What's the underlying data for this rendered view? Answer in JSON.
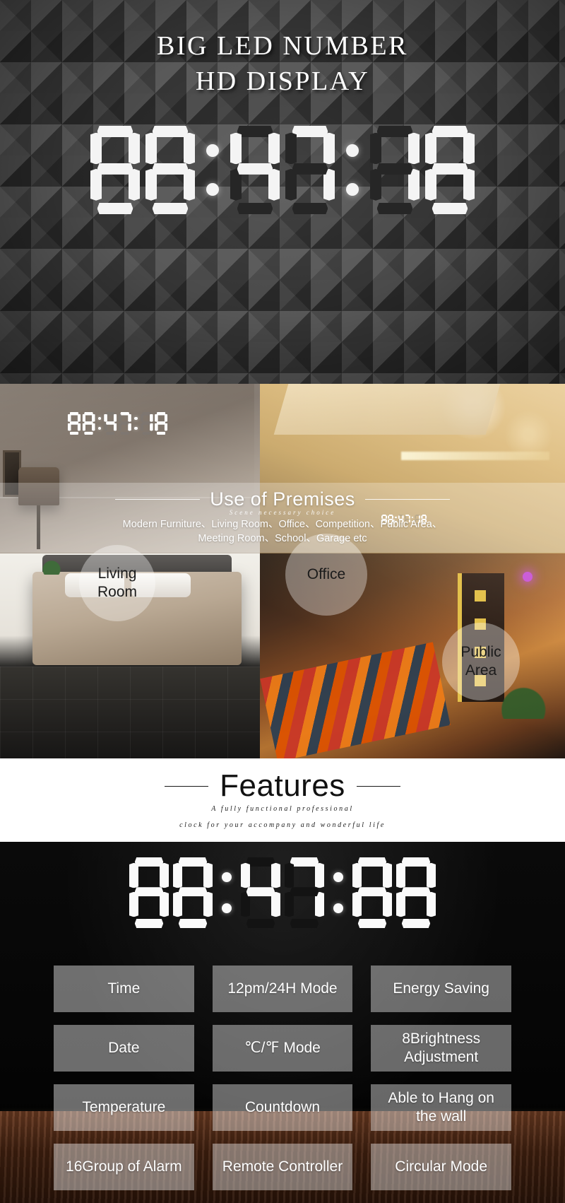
{
  "hero": {
    "title_line1": "BIG LED NUMBER",
    "title_line2": "HD DISPLAY",
    "clock_time": "88:47:18",
    "digits": [
      "8",
      "8",
      "4",
      "7",
      "1",
      "8"
    ]
  },
  "premises": {
    "title": "Use of Premises",
    "subtitle": "Scene necessary choice",
    "list_line1": "Modern Furniture、Living Room、Office、Competition、Public Area、",
    "list_line2": "Meeting Room、School、Garage etc",
    "badges": [
      {
        "id": "living-room",
        "line1": "Living",
        "line2": "Room"
      },
      {
        "id": "office",
        "line1": "Office",
        "line2": ""
      },
      {
        "id": "public-area",
        "line1": "Public",
        "line2": "Area"
      }
    ],
    "mini_clock_time": "88:47:18"
  },
  "features_header": {
    "title": "Features",
    "subtitle_line1": "A fully functional professional",
    "subtitle_line2": "clock for your accompany and wonderful life"
  },
  "features_grid": {
    "clock_time": "88:47:88",
    "items": [
      "Time",
      "12pm/24H Mode",
      "Energy Saving",
      "Date",
      "℃/℉ Mode",
      "8Brightness Adjustment",
      "Temperature",
      "Countdown",
      "Able to Hang on the wall",
      "16Group of Alarm",
      "Remote Controller",
      "Circular Mode"
    ]
  },
  "colors": {
    "hero_bg": "#3b3b3b",
    "led_white": "#f2f2f2",
    "panel_bg": "#050505",
    "cell_bg": "rgba(255,255,255,0.40)",
    "text_white": "#ffffff"
  }
}
